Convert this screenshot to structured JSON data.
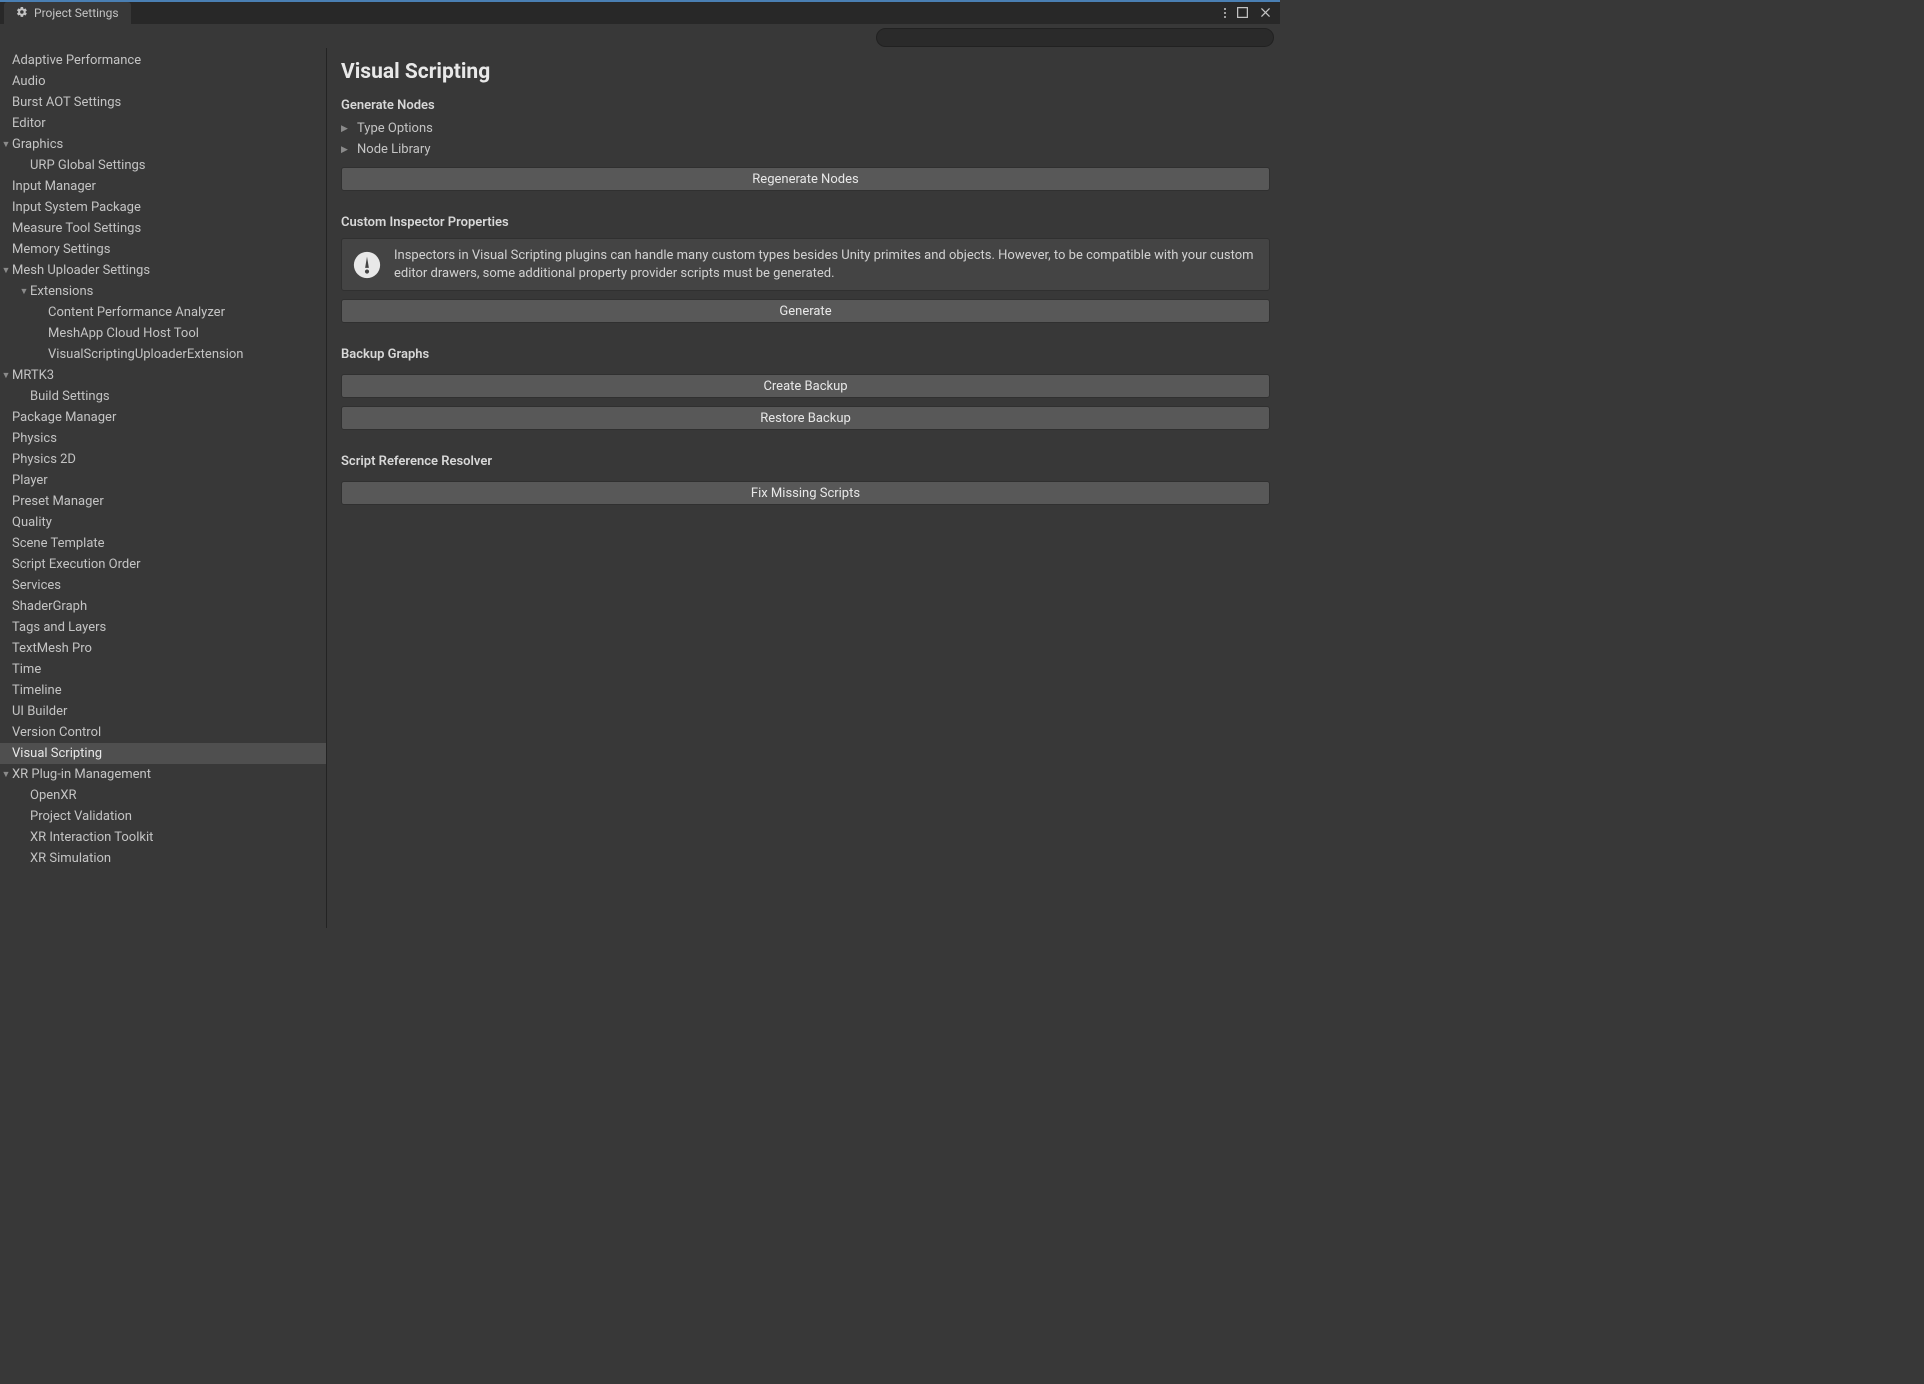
{
  "tab_title": "Project Settings",
  "search": {
    "value": ""
  },
  "sidebar": {
    "items": [
      {
        "label": "Adaptive Performance",
        "depth": 1,
        "arrow": ""
      },
      {
        "label": "Audio",
        "depth": 1,
        "arrow": ""
      },
      {
        "label": "Burst AOT Settings",
        "depth": 1,
        "arrow": ""
      },
      {
        "label": "Editor",
        "depth": 1,
        "arrow": ""
      },
      {
        "label": "Graphics",
        "depth": 1,
        "arrow": "down"
      },
      {
        "label": "URP Global Settings",
        "depth": 2,
        "arrow": ""
      },
      {
        "label": "Input Manager",
        "depth": 1,
        "arrow": ""
      },
      {
        "label": "Input System Package",
        "depth": 1,
        "arrow": ""
      },
      {
        "label": "Measure Tool Settings",
        "depth": 1,
        "arrow": ""
      },
      {
        "label": "Memory Settings",
        "depth": 1,
        "arrow": ""
      },
      {
        "label": "Mesh Uploader Settings",
        "depth": 1,
        "arrow": "down"
      },
      {
        "label": "Extensions",
        "depth": 2,
        "arrow": "down"
      },
      {
        "label": "Content Performance Analyzer",
        "depth": 3,
        "arrow": ""
      },
      {
        "label": "MeshApp Cloud Host Tool",
        "depth": 3,
        "arrow": ""
      },
      {
        "label": "VisualScriptingUploaderExtension",
        "depth": 3,
        "arrow": ""
      },
      {
        "label": "MRTK3",
        "depth": 1,
        "arrow": "down"
      },
      {
        "label": "Build Settings",
        "depth": 2,
        "arrow": ""
      },
      {
        "label": "Package Manager",
        "depth": 1,
        "arrow": ""
      },
      {
        "label": "Physics",
        "depth": 1,
        "arrow": ""
      },
      {
        "label": "Physics 2D",
        "depth": 1,
        "arrow": ""
      },
      {
        "label": "Player",
        "depth": 1,
        "arrow": ""
      },
      {
        "label": "Preset Manager",
        "depth": 1,
        "arrow": ""
      },
      {
        "label": "Quality",
        "depth": 1,
        "arrow": ""
      },
      {
        "label": "Scene Template",
        "depth": 1,
        "arrow": ""
      },
      {
        "label": "Script Execution Order",
        "depth": 1,
        "arrow": ""
      },
      {
        "label": "Services",
        "depth": 1,
        "arrow": ""
      },
      {
        "label": "ShaderGraph",
        "depth": 1,
        "arrow": ""
      },
      {
        "label": "Tags and Layers",
        "depth": 1,
        "arrow": ""
      },
      {
        "label": "TextMesh Pro",
        "depth": 1,
        "arrow": ""
      },
      {
        "label": "Time",
        "depth": 1,
        "arrow": ""
      },
      {
        "label": "Timeline",
        "depth": 1,
        "arrow": ""
      },
      {
        "label": "UI Builder",
        "depth": 1,
        "arrow": ""
      },
      {
        "label": "Version Control",
        "depth": 1,
        "arrow": ""
      },
      {
        "label": "Visual Scripting",
        "depth": 1,
        "arrow": "",
        "selected": true
      },
      {
        "label": "XR Plug-in Management",
        "depth": 1,
        "arrow": "down"
      },
      {
        "label": "OpenXR",
        "depth": 2,
        "arrow": ""
      },
      {
        "label": "Project Validation",
        "depth": 2,
        "arrow": ""
      },
      {
        "label": "XR Interaction Toolkit",
        "depth": 2,
        "arrow": ""
      },
      {
        "label": "XR Simulation",
        "depth": 2,
        "arrow": ""
      }
    ]
  },
  "main": {
    "title": "Visual Scripting",
    "sections": {
      "generate_nodes": {
        "header": "Generate Nodes",
        "foldouts": {
          "type_options": "Type Options",
          "node_library": "Node Library"
        },
        "regenerate_btn": "Regenerate Nodes"
      },
      "custom_inspector": {
        "header": "Custom Inspector Properties",
        "info_text": "Inspectors in Visual Scripting plugins can handle many custom types besides Unity primites and objects. However, to be compatible with your custom editor drawers, some additional property provider scripts must be generated.",
        "generate_btn": "Generate"
      },
      "backup": {
        "header": "Backup Graphs",
        "create_btn": "Create Backup",
        "restore_btn": "Restore Backup"
      },
      "resolver": {
        "header": "Script Reference Resolver",
        "fix_btn": "Fix Missing Scripts"
      }
    }
  }
}
